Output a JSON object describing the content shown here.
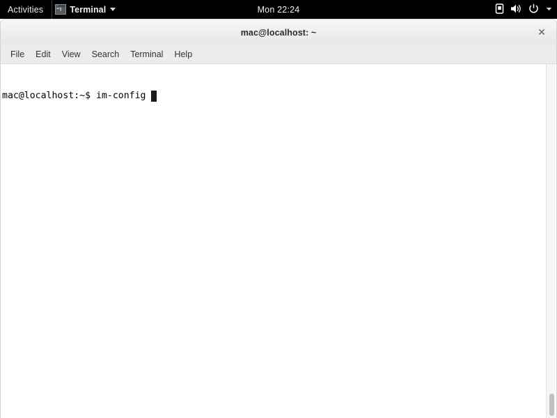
{
  "topbar": {
    "activities_label": "Activities",
    "app_menu": {
      "label": "Terminal",
      "icon": "terminal-app-icon",
      "caret": "chevron-down-icon"
    },
    "clock": "Mon 22:24",
    "status_icons": [
      {
        "name": "display-icon",
        "glyph": "▭"
      },
      {
        "name": "volume-icon",
        "glyph": "🔊"
      },
      {
        "name": "power-icon",
        "glyph": "⏻"
      },
      {
        "name": "chevron-down-icon",
        "glyph": "▾"
      }
    ],
    "background_color": "#000000",
    "text_color": "#f2f2f2"
  },
  "window": {
    "title": "mac@localhost: ~",
    "close_label": "✕",
    "titlebar_color": "#eeeeee"
  },
  "menubar": {
    "items": [
      {
        "label": "File"
      },
      {
        "label": "Edit"
      },
      {
        "label": "View"
      },
      {
        "label": "Search"
      },
      {
        "label": "Terminal"
      },
      {
        "label": "Help"
      }
    ],
    "background_color": "#ececec",
    "text_color": "#2e3436"
  },
  "terminal": {
    "background_color": "#ffffff",
    "foreground_color": "#000000",
    "lines": [
      {
        "prompt": "mac@localhost:~$",
        "command": "im-config",
        "has_cursor": true
      }
    ],
    "prompt": "mac@localhost:~$",
    "command": "im-config",
    "cursor_color": "#1a1a1a"
  },
  "scrollbar": {
    "track_color": "#f6f6f6",
    "thumb_color": "#c0c0c0",
    "position": "bottom"
  }
}
